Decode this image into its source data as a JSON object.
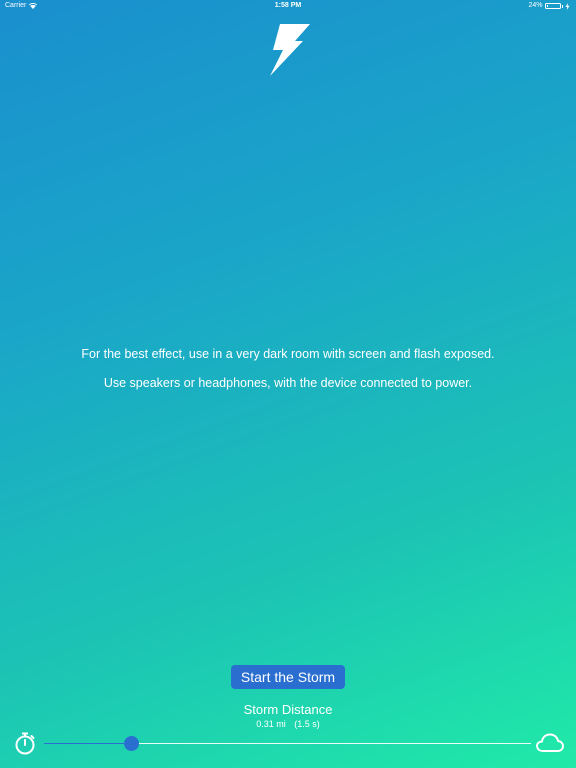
{
  "status_bar": {
    "carrier": "Carrier",
    "time": "1:58 PM",
    "battery_percent": "24%",
    "battery_level": 0.24,
    "signal_icon": "wifi-icon",
    "charging_icon": "charging-bolt-icon"
  },
  "logo": {
    "icon": "lightning-bolt-icon"
  },
  "instructions": {
    "line1": "For the best effect, use in a very dark room with screen and flash exposed.",
    "line2": "Use speakers or headphones, with the device connected to power."
  },
  "start_button": {
    "label": "Start the Storm"
  },
  "storm_distance": {
    "title": "Storm Distance",
    "miles": "0.31 mi",
    "seconds": "(1.5 s)",
    "slider_fraction": 0.18,
    "left_icon": "stopwatch-icon",
    "right_icon": "cloud-icon"
  },
  "colors": {
    "accent": "#2a6fd0",
    "gradient_top": "#1a8fce",
    "gradient_bottom": "#20eaa8",
    "text": "#ffffff"
  }
}
